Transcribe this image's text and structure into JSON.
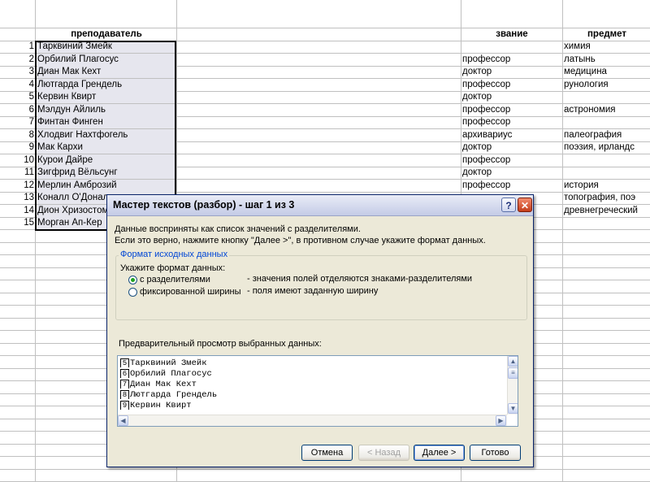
{
  "sheet": {
    "headers": {
      "col_b": "преподаватель",
      "col_e": "звание",
      "col_f": "предмет"
    },
    "rows": [
      {
        "num": "1",
        "name": "Тарквиний Змейк",
        "rank": "",
        "subject": "химия"
      },
      {
        "num": "2",
        "name": "Орбилий Плагосус",
        "rank": "профессор",
        "subject": "латынь"
      },
      {
        "num": "3",
        "name": "Диан Мак Кехт",
        "rank": "доктор",
        "subject": "медицина"
      },
      {
        "num": "4",
        "name": "Лютгарда Грендель",
        "rank": "профессор",
        "subject": "рунология"
      },
      {
        "num": "5",
        "name": "Кервин Квирт",
        "rank": "доктор",
        "subject": ""
      },
      {
        "num": "6",
        "name": "Мэлдун Айлиль",
        "rank": "профессор",
        "subject": "астрономия"
      },
      {
        "num": "7",
        "name": "Финтан Финген",
        "rank": "профессор",
        "subject": ""
      },
      {
        "num": "8",
        "name": "Хлодвиг Нахтфогель",
        "rank": "архивариус",
        "subject": "палеография"
      },
      {
        "num": "9",
        "name": "Мак Кархи",
        "rank": "доктор",
        "subject": "поэзия, ирландс"
      },
      {
        "num": "10",
        "name": "Курои Дайре",
        "rank": "профессор",
        "subject": ""
      },
      {
        "num": "11",
        "name": "Зигфрид Вёльсунг",
        "rank": "доктор",
        "subject": ""
      },
      {
        "num": "12",
        "name": "Мерлин Амброзий",
        "rank": "профессор",
        "subject": "история"
      },
      {
        "num": "13",
        "name": "Коналл О'Донал",
        "rank": "",
        "subject": "топография, поэ"
      },
      {
        "num": "14",
        "name": "Дион Хризостом",
        "rank": "",
        "subject": "древнегреческий"
      },
      {
        "num": "15",
        "name": "Морган Ап-Кер",
        "rank": "",
        "subject": ""
      }
    ]
  },
  "dialog": {
    "title": "Мастер текстов (разбор) - шаг 1 из 3",
    "help_label": "?",
    "close_label": "✕",
    "intro_line1": "Данные восприняты как список значений с разделителями.",
    "intro_line2": "Если это верно, нажмите кнопку \"Далее >\", в противном случае укажите формат данных.",
    "group_label": "Формат исходных данных",
    "format_prompt": "Укажите формат данных:",
    "option1": {
      "label": "с разделителями",
      "desc": "- значения полей отделяются знаками-разделителями",
      "checked": true
    },
    "option2": {
      "label": "фиксированной ширины",
      "desc": "- поля имеют заданную ширину",
      "checked": false
    },
    "preview_label": "Предварительный просмотр выбранных данных:",
    "preview_lines": [
      {
        "num": "5",
        "text": "Тарквиний Змейк"
      },
      {
        "num": "6",
        "text": "Орбилий Плагосус"
      },
      {
        "num": "7",
        "text": "Диан Мак Кехт"
      },
      {
        "num": "8",
        "text": "Лютгарда Грендель"
      },
      {
        "num": "9",
        "text": "Кервин Квирт"
      }
    ],
    "buttons": {
      "cancel": "Отмена",
      "back": "< Назад",
      "next": "Далее >",
      "finish": "Готово"
    }
  }
}
